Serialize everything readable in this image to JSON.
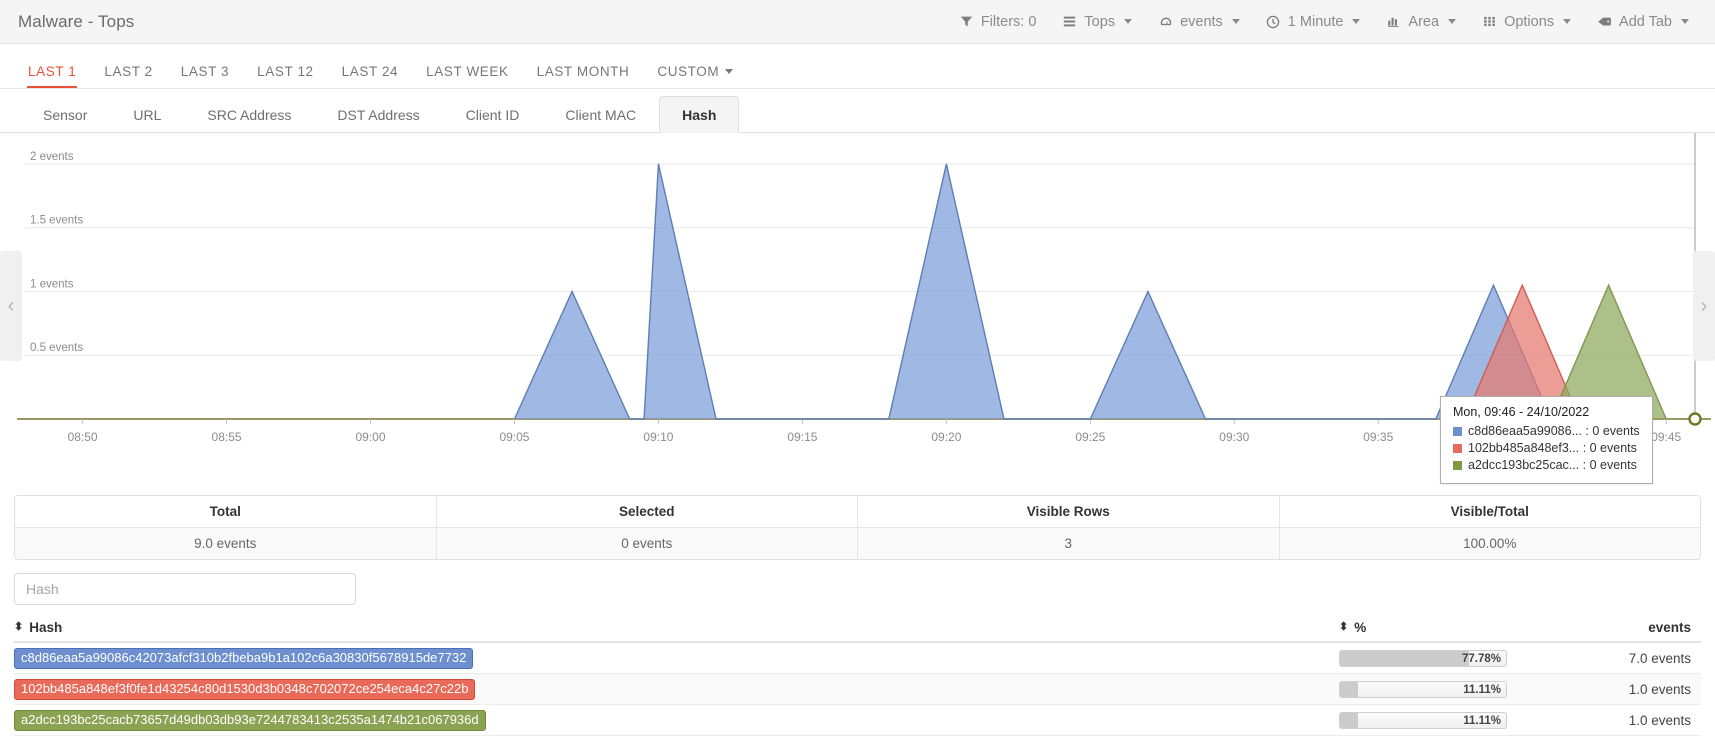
{
  "header": {
    "title": "Malware - Tops",
    "toolbar": [
      {
        "label": "Filters: 0",
        "icon": "filter-icon",
        "caret": false
      },
      {
        "label": "Tops",
        "icon": "list-icon",
        "caret": true
      },
      {
        "label": "events",
        "icon": "speedometer-icon",
        "caret": true
      },
      {
        "label": "1 Minute",
        "icon": "clock-icon",
        "caret": true
      },
      {
        "label": "Area",
        "icon": "bar-chart-icon",
        "caret": true
      },
      {
        "label": "Options",
        "icon": "grid-icon",
        "caret": true
      },
      {
        "label": "Add Tab",
        "icon": "tag-icon",
        "caret": true
      }
    ]
  },
  "ranges": {
    "active": "LAST 1",
    "items": [
      {
        "label": "LAST 1",
        "caret": false
      },
      {
        "label": "LAST 2",
        "caret": false
      },
      {
        "label": "LAST 3",
        "caret": false
      },
      {
        "label": "LAST 12",
        "caret": false
      },
      {
        "label": "LAST 24",
        "caret": false
      },
      {
        "label": "LAST WEEK",
        "caret": false
      },
      {
        "label": "LAST MONTH",
        "caret": false
      },
      {
        "label": "CUSTOM",
        "caret": true
      }
    ]
  },
  "subtabs": {
    "active": "Hash",
    "items": [
      {
        "label": "Sensor"
      },
      {
        "label": "URL"
      },
      {
        "label": "SRC Address"
      },
      {
        "label": "DST Address"
      },
      {
        "label": "Client ID"
      },
      {
        "label": "Client MAC"
      },
      {
        "label": "Hash"
      }
    ]
  },
  "chart_data": {
    "type": "area",
    "title": "",
    "xlabel": "",
    "ylabel": "events",
    "grid": true,
    "legend_position": "none",
    "xtick_labels": [
      "08:50",
      "08:55",
      "09:00",
      "09:05",
      "09:10",
      "09:15",
      "09:20",
      "09:25",
      "09:30",
      "09:35",
      "09:40",
      "09:45"
    ],
    "ytick_labels": [
      "0.5 events",
      "1 events",
      "1.5 events",
      "2 events"
    ],
    "ytick_values": [
      0.5,
      1,
      1.5,
      2
    ],
    "ylim": [
      0,
      2.18
    ],
    "xlim": [
      "08:48",
      "09:46"
    ],
    "series": [
      {
        "name": "c8d86eaa5a99086c42073afcf310b2fbeba9b1a102c6a30830f5678915de7732",
        "color": "#7b9ed9",
        "stroke": "#5878b0",
        "points": [
          {
            "x": "09:05",
            "y": 0
          },
          {
            "x": "09:07",
            "y": 1
          },
          {
            "x": "09:09",
            "y": 0
          },
          {
            "x": "09:0930",
            "y": 0
          },
          {
            "x": "09:10",
            "y": 2
          },
          {
            "x": "09:12",
            "y": 0
          },
          {
            "x": "09:18",
            "y": 0
          },
          {
            "x": "09:20",
            "y": 2
          },
          {
            "x": "09:22",
            "y": 0
          },
          {
            "x": "09:25",
            "y": 0
          },
          {
            "x": "09:27",
            "y": 1
          },
          {
            "x": "09:29",
            "y": 0
          },
          {
            "x": "09:37",
            "y": 0
          },
          {
            "x": "09:39",
            "y": 1.05
          },
          {
            "x": "09:41",
            "y": 0
          }
        ]
      },
      {
        "name": "102bb485a848ef3f0fe1d43254c80d1530d3b0348c702072ce254eca4c27c22b",
        "color": "#e4796e",
        "stroke": "#cc5a4e",
        "points": [
          {
            "x": "09:38",
            "y": 0
          },
          {
            "x": "09:40",
            "y": 1.05
          },
          {
            "x": "09:42",
            "y": 0
          }
        ]
      },
      {
        "name": "a2dcc193bc25cacb73657d49db03db93e7244783413c2535a1474b21c067936d",
        "color": "#8fa85c",
        "stroke": "#7a9348",
        "points": [
          {
            "x": "09:41",
            "y": 0
          },
          {
            "x": "09:43",
            "y": 1.05
          },
          {
            "x": "09:45",
            "y": 0
          }
        ]
      }
    ],
    "cursor": {
      "x": "09:46",
      "marker": "circle",
      "color": "#6b7a25"
    }
  },
  "tooltip": {
    "title": "Mon, 09:46 - 24/10/2022",
    "rows": [
      {
        "swatch": "#6d8fd0",
        "text": "c8d86eaa5a99086... : 0 events"
      },
      {
        "swatch": "#ea6a5a",
        "text": "102bb485a848ef3... : 0 events"
      },
      {
        "swatch": "#7d9a45",
        "text": "a2dcc193bc25cac... : 0 events"
      }
    ]
  },
  "nav": {
    "left": "‹",
    "right": "›"
  },
  "stats": {
    "headers": [
      "Total",
      "Selected",
      "Visible Rows",
      "Visible/Total"
    ],
    "values": [
      "9.0 events",
      "0 events",
      "3",
      "100.00%"
    ]
  },
  "search": {
    "placeholder": "Hash",
    "value": ""
  },
  "table": {
    "headers": {
      "hash": "Hash",
      "pct": "%",
      "events": "events"
    },
    "rows": [
      {
        "hash": "c8d86eaa5a99086c42073afcf310b2fbeba9b1a102c6a30830f5678915de7732",
        "color": "#6d8fd0",
        "border": "#4a6fb5",
        "pct_label": "77.78%",
        "pct_value": 77.78,
        "events": "7.0 events"
      },
      {
        "hash": "102bb485a848ef3f0fe1d43254c80d1530d3b0348c702072ce254eca4c27c22b",
        "color": "#ea6a5a",
        "border": "#d1493a",
        "pct_label": "11.11%",
        "pct_value": 11.11,
        "events": "1.0 events"
      },
      {
        "hash": "a2dcc193bc25cacb73657d49db03db93e7244783413c2535a1474b21c067936d",
        "color": "#8aa252",
        "border": "#6e8a38",
        "pct_label": "11.11%",
        "pct_value": 11.11,
        "events": "1.0 events"
      }
    ]
  }
}
